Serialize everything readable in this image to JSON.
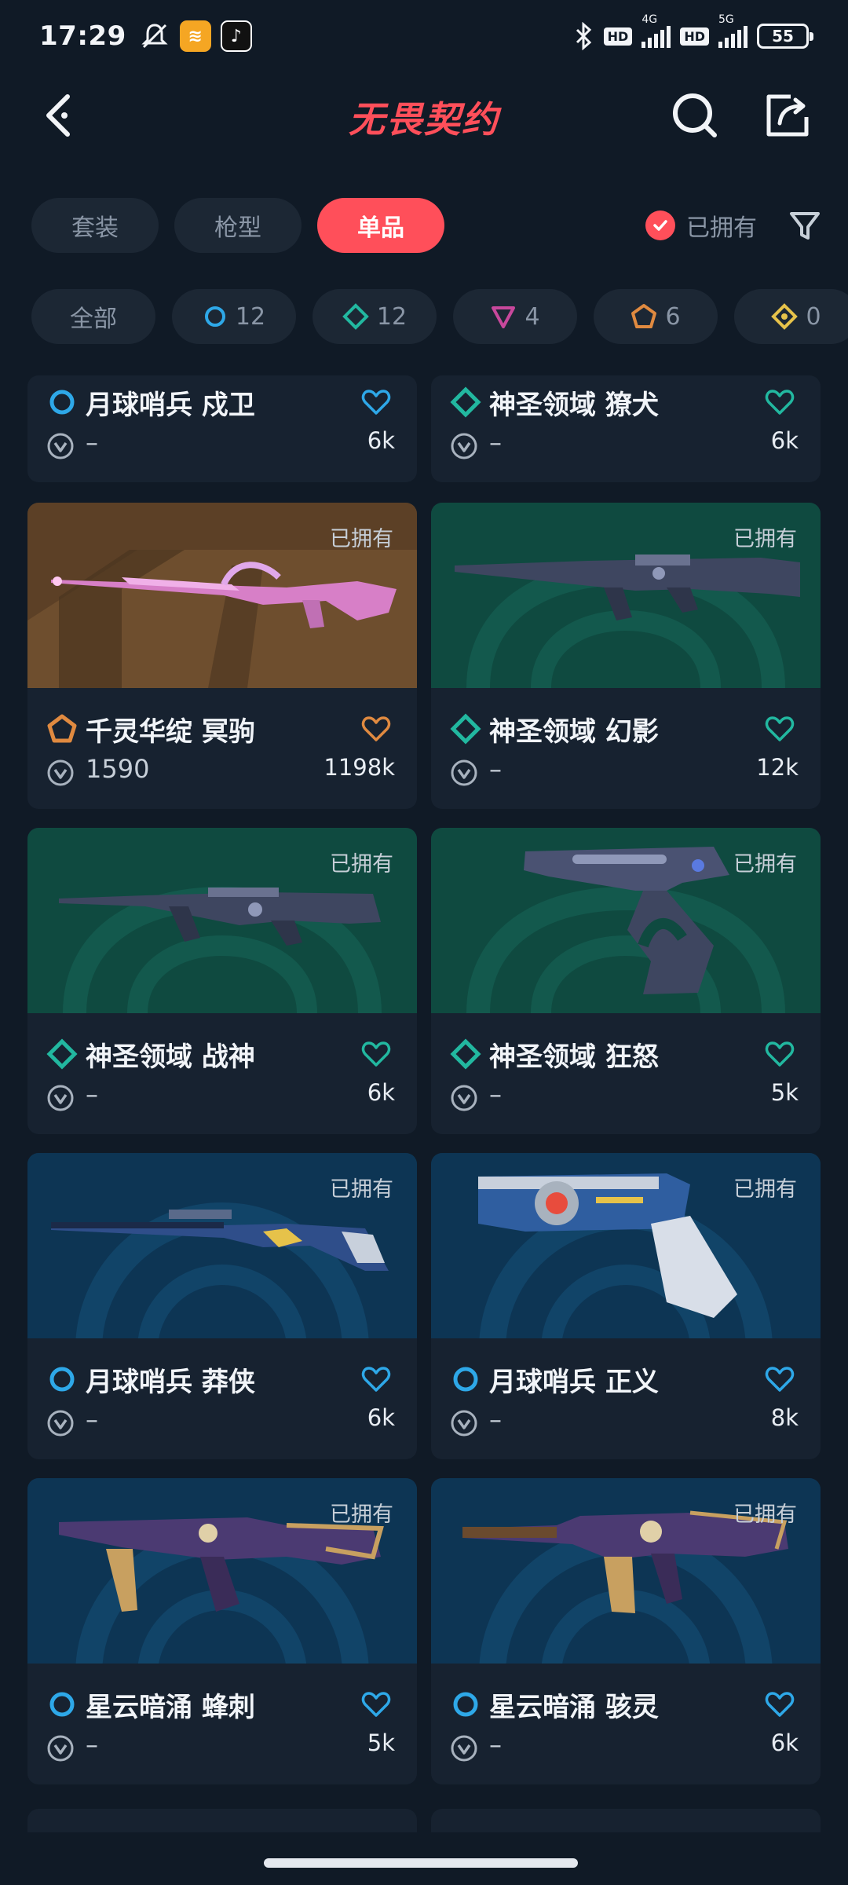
{
  "status_bar": {
    "time": "17:29",
    "network_4g": "4G",
    "network_5g": "5G",
    "hd": "HD",
    "battery": "55"
  },
  "header": {
    "title": "无畏契约"
  },
  "tabs": [
    {
      "label": "套装",
      "active": false
    },
    {
      "label": "枪型",
      "active": false
    },
    {
      "label": "单品",
      "active": true
    }
  ],
  "owned_filter": {
    "label": "已拥有",
    "checked": true
  },
  "rarity_filters": [
    {
      "label": "全部",
      "icon": "all"
    },
    {
      "label": "12",
      "icon": "select-tier-icon"
    },
    {
      "label": "12",
      "icon": "deluxe-tier-icon"
    },
    {
      "label": "4",
      "icon": "premium-tier-icon"
    },
    {
      "label": "6",
      "icon": "exclusive-tier-icon"
    },
    {
      "label": "0",
      "icon": "ultra-tier-icon"
    }
  ],
  "colors": {
    "accent": "#ff4f5a",
    "select_blue": "#2ea8e8",
    "deluxe_teal": "#22b8a0",
    "premium_purple": "#c8489c",
    "exclusive_orange": "#e08a40",
    "ultra_gold": "#e6c24a"
  },
  "owned_tag": "已拥有",
  "skins": [
    {
      "name": "月球哨兵 戍卫",
      "price": "–",
      "likes": "6k",
      "tier": "select"
    },
    {
      "name": "神圣领域 獠犬",
      "price": "–",
      "likes": "6k",
      "tier": "deluxe"
    },
    {
      "name": "千灵华绽 冥驹",
      "price": "1590",
      "likes": "1198k",
      "tier": "exclusive",
      "owned": "已拥有"
    },
    {
      "name": "神圣领域 幻影",
      "price": "–",
      "likes": "12k",
      "tier": "deluxe",
      "owned": "已拥有"
    },
    {
      "name": "神圣领域 战神",
      "price": "–",
      "likes": "6k",
      "tier": "deluxe",
      "owned": "已拥有"
    },
    {
      "name": "神圣领域 狂怒",
      "price": "–",
      "likes": "5k",
      "tier": "deluxe",
      "owned": "已拥有"
    },
    {
      "name": "月球哨兵 莽侠",
      "price": "–",
      "likes": "6k",
      "tier": "select",
      "owned": "已拥有"
    },
    {
      "name": "月球哨兵 正义",
      "price": "–",
      "likes": "8k",
      "tier": "select",
      "owned": "已拥有"
    },
    {
      "name": "星云暗涌 蜂刺",
      "price": "–",
      "likes": "5k",
      "tier": "select",
      "owned": "已拥有"
    },
    {
      "name": "星云暗涌 骇灵",
      "price": "–",
      "likes": "6k",
      "tier": "select",
      "owned": "已拥有"
    }
  ]
}
